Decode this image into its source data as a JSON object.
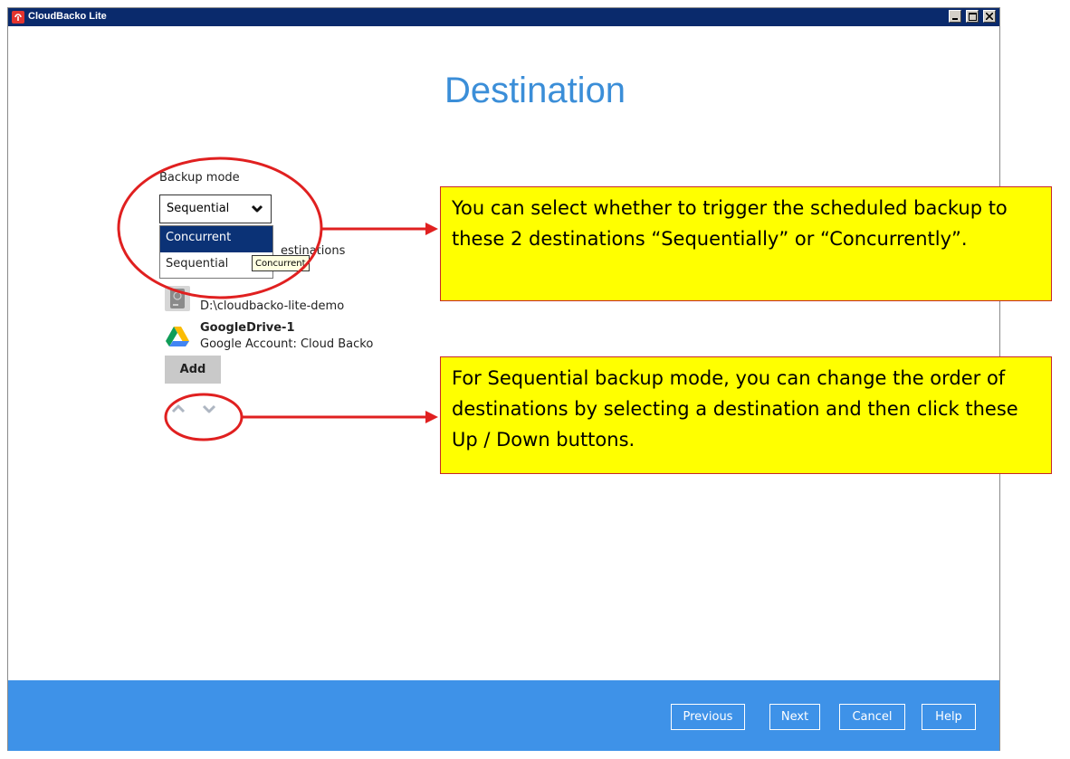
{
  "window": {
    "title": "CloudBacko Lite"
  },
  "page": {
    "title": "Destination"
  },
  "backup_mode": {
    "label": "Backup mode",
    "selected": "Sequential",
    "options": [
      "Concurrent",
      "Sequential"
    ],
    "tooltip": "Concurrent"
  },
  "destinations": {
    "header_partial": "estinations",
    "items": [
      {
        "icon": "local-drive-icon",
        "path": "D:\\cloudbacko-lite-demo"
      },
      {
        "icon": "google-drive-icon",
        "name": "GoogleDrive-1",
        "account": "Google Account: Cloud Backo"
      }
    ],
    "add_label": "Add"
  },
  "footer": {
    "previous": "Previous",
    "next": "Next",
    "cancel": "Cancel",
    "help": "Help"
  },
  "callouts": {
    "mode": "You can select whether to trigger the scheduled backup to these 2 destinations “Sequentially” or “Concurrently”.",
    "order": "For Sequential backup mode, you can change the order of destinations by selecting a destination and then click these Up / Down buttons."
  },
  "colors": {
    "accent": "#3b8ed8",
    "footer": "#3e92e8",
    "selection": "#0b3276",
    "callout_bg": "#ffff00",
    "annotation": "#e02020",
    "titlebar": "#0a2a6c"
  }
}
